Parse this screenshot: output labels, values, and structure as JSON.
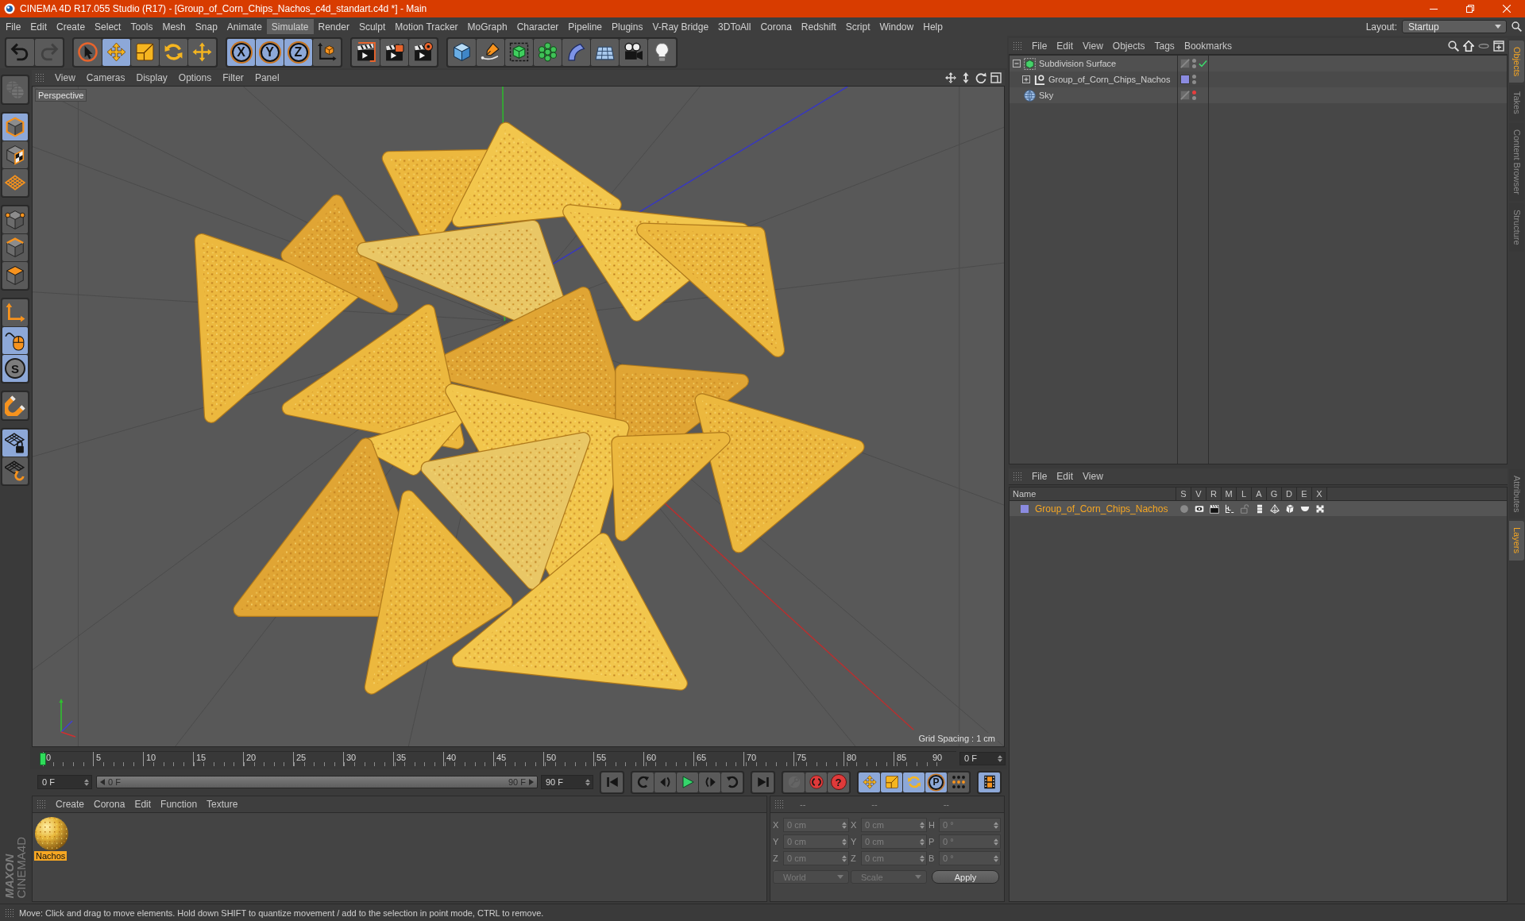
{
  "window": {
    "title": "CINEMA 4D R17.055 Studio (R17) - [Group_of_Corn_Chips_Nachos_c4d_standart.c4d *] - Main"
  },
  "menubar": {
    "items": [
      {
        "label": "File",
        "selected": false
      },
      {
        "label": "Edit",
        "selected": false
      },
      {
        "label": "Create",
        "selected": false
      },
      {
        "label": "Select",
        "selected": false
      },
      {
        "label": "Tools",
        "selected": false
      },
      {
        "label": "Mesh",
        "selected": false
      },
      {
        "label": "Snap",
        "selected": false
      },
      {
        "label": "Animate",
        "selected": false
      },
      {
        "label": "Simulate",
        "selected": true
      },
      {
        "label": "Render",
        "selected": false
      },
      {
        "label": "Sculpt",
        "selected": false
      },
      {
        "label": "Motion Tracker",
        "selected": false
      },
      {
        "label": "MoGraph",
        "selected": false
      },
      {
        "label": "Character",
        "selected": false
      },
      {
        "label": "Pipeline",
        "selected": false
      },
      {
        "label": "Plugins",
        "selected": false
      },
      {
        "label": "V-Ray Bridge",
        "selected": false
      },
      {
        "label": "3DToAll",
        "selected": false
      },
      {
        "label": "Corona",
        "selected": false
      },
      {
        "label": "Redshift",
        "selected": false
      },
      {
        "label": "Script",
        "selected": false
      },
      {
        "label": "Window",
        "selected": false
      },
      {
        "label": "Help",
        "selected": false
      }
    ],
    "layout_label": "Layout:",
    "layout_value": "Startup"
  },
  "toolbar": {
    "groups": [
      {
        "buttons": [
          {
            "kind": "undo",
            "active": false,
            "disabled": false
          },
          {
            "kind": "redo",
            "active": false,
            "disabled": true
          }
        ]
      },
      {
        "buttons": [
          {
            "kind": "select",
            "active": false,
            "disabled": false
          },
          {
            "kind": "move",
            "active": true,
            "disabled": false
          },
          {
            "kind": "scale",
            "active": false,
            "disabled": false
          },
          {
            "kind": "rotate",
            "active": false,
            "disabled": false
          },
          {
            "kind": "transform",
            "active": false,
            "disabled": false
          }
        ]
      },
      {
        "buttons": [
          {
            "kind": "axis",
            "label": "X",
            "active": true,
            "disabled": false
          },
          {
            "kind": "axis",
            "label": "Y",
            "active": true,
            "disabled": false
          },
          {
            "kind": "axis",
            "label": "Z",
            "active": true,
            "disabled": false
          },
          {
            "kind": "coordsys",
            "active": false,
            "disabled": false
          }
        ]
      },
      {
        "buttons": [
          {
            "kind": "renderview",
            "active": false,
            "disabled": false
          },
          {
            "kind": "renderpicture",
            "active": false,
            "disabled": false
          },
          {
            "kind": "rendersettings",
            "active": false,
            "disabled": false
          }
        ]
      },
      {
        "buttons": [
          {
            "kind": "cube",
            "active": false,
            "disabled": false
          },
          {
            "kind": "pen",
            "active": false,
            "disabled": false
          },
          {
            "kind": "subdivision",
            "active": false,
            "disabled": false
          },
          {
            "kind": "cloner",
            "active": false,
            "disabled": false
          },
          {
            "kind": "bend",
            "active": false,
            "disabled": false
          },
          {
            "kind": "floor",
            "active": false,
            "disabled": false
          },
          {
            "kind": "camera",
            "active": false,
            "disabled": false
          },
          {
            "kind": "light",
            "active": false,
            "disabled": false
          }
        ]
      }
    ]
  },
  "left_tools": {
    "groups": [
      {
        "buttons": [
          {
            "kind": "editable",
            "active": false,
            "disabled": true
          }
        ]
      },
      {
        "buttons": [
          {
            "kind": "model",
            "active": true,
            "disabled": false
          },
          {
            "kind": "texture",
            "active": false,
            "disabled": false
          },
          {
            "kind": "workplane",
            "active": false,
            "disabled": false
          }
        ]
      },
      {
        "buttons": [
          {
            "kind": "points",
            "active": false,
            "disabled": false
          },
          {
            "kind": "edges",
            "active": false,
            "disabled": false
          },
          {
            "kind": "polygons",
            "active": false,
            "disabled": false
          }
        ]
      },
      {
        "buttons": [
          {
            "kind": "axismode",
            "active": false,
            "disabled": false
          },
          {
            "kind": "tweak",
            "active": true,
            "disabled": false
          },
          {
            "kind": "solo",
            "label": "S",
            "active": true,
            "disabled": false
          }
        ]
      },
      {
        "buttons": [
          {
            "kind": "snap",
            "active": false,
            "disabled": false
          }
        ]
      },
      {
        "buttons": [
          {
            "kind": "planelock",
            "active": true,
            "disabled": false
          },
          {
            "kind": "planealign",
            "active": false,
            "disabled": false
          }
        ]
      }
    ]
  },
  "viewport": {
    "menu": [
      "View",
      "Cameras",
      "Display",
      "Options",
      "Filter",
      "Panel"
    ],
    "camera": "Perspective",
    "grid_spacing": "Grid Spacing : 1 cm"
  },
  "timeline": {
    "ruler_labels": [
      "0",
      "5",
      "10",
      "15",
      "20",
      "25",
      "30",
      "35",
      "40",
      "45",
      "50",
      "55",
      "60",
      "65",
      "70",
      "75",
      "80",
      "85",
      "90"
    ],
    "level": 0,
    "current_frame": "0 F"
  },
  "playback": {
    "start_field": "0 F",
    "range": {
      "start": "0 F",
      "end": "90 F",
      "level": 1
    },
    "end_field": "90 F",
    "groups": [
      {
        "buttons": [
          {
            "kind": "start",
            "active": false,
            "disabled": false
          }
        ]
      },
      {
        "buttons": [
          {
            "kind": "prevkey",
            "active": false,
            "disabled": false
          },
          {
            "kind": "prevframe",
            "active": false,
            "disabled": false
          },
          {
            "kind": "play",
            "active": false,
            "disabled": false
          },
          {
            "kind": "nextframe",
            "active": false,
            "disabled": false
          },
          {
            "kind": "nextkey",
            "active": false,
            "disabled": false
          }
        ]
      },
      {
        "buttons": [
          {
            "kind": "end",
            "active": false,
            "disabled": false
          }
        ]
      },
      {
        "buttons": [
          {
            "kind": "autokey",
            "active": false,
            "disabled": true
          },
          {
            "kind": "record",
            "active": false,
            "disabled": false
          },
          {
            "kind": "keyselect",
            "label": "?",
            "active": false,
            "disabled": false
          }
        ]
      },
      {
        "buttons": [
          {
            "kind": "poskey",
            "active": true,
            "disabled": false
          },
          {
            "kind": "scalekey",
            "active": true,
            "disabled": false
          },
          {
            "kind": "rotkey",
            "active": true,
            "disabled": false
          },
          {
            "kind": "paramkey",
            "label": "P",
            "active": true,
            "disabled": false
          },
          {
            "kind": "plakey",
            "active": false,
            "disabled": false
          }
        ]
      },
      {
        "buttons": [
          {
            "kind": "timeline",
            "active": true,
            "disabled": false
          }
        ]
      }
    ]
  },
  "material_manager": {
    "menu": [
      "Create",
      "Corona",
      "Edit",
      "Function",
      "Texture"
    ],
    "materials": [
      {
        "name": "Nachos",
        "selected": true
      }
    ]
  },
  "coordinates": {
    "headers": [
      "--",
      "--",
      "--"
    ],
    "disabled": true,
    "rows": [
      {
        "cells": [
          {
            "label": "X",
            "value": "0 cm"
          },
          {
            "label": "X",
            "value": "0 cm"
          },
          {
            "label": "H",
            "value": "0 °"
          }
        ]
      },
      {
        "cells": [
          {
            "label": "Y",
            "value": "0 cm"
          },
          {
            "label": "Y",
            "value": "0 cm"
          },
          {
            "label": "P",
            "value": "0 °"
          }
        ]
      },
      {
        "cells": [
          {
            "label": "Z",
            "value": "0 cm"
          },
          {
            "label": "Z",
            "value": "0 cm"
          },
          {
            "label": "B",
            "value": "0 °"
          }
        ]
      }
    ],
    "mode": "World",
    "size_mode": "Scale",
    "apply": "Apply"
  },
  "logo": {
    "lines": [
      "MAXON",
      "CINEMA4D"
    ]
  },
  "object_manager": {
    "menu": [
      "File",
      "Edit",
      "View",
      "Objects",
      "Tags",
      "Bookmarks"
    ],
    "objects": [
      {
        "name": "Subdivision Surface",
        "kind": "subdivision",
        "selected": false,
        "expanded": true,
        "enabled": true,
        "editor_hidden": false,
        "render_hidden": false,
        "children": [
          {
            "name": "Group_of_Corn_Chips_Nachos",
            "kind": "null",
            "selected": false,
            "expanded": false,
            "color": "#8b8be0",
            "editor_hidden": false,
            "render_hidden": false
          }
        ]
      },
      {
        "name": "Sky",
        "kind": "sky",
        "selected": false,
        "editor_hidden": true,
        "render_hidden": false
      }
    ]
  },
  "layer_manager": {
    "menu": [
      "File",
      "Edit",
      "View"
    ],
    "columns": [
      "Name",
      "S",
      "V",
      "R",
      "M",
      "L",
      "A",
      "G",
      "D",
      "E",
      "X"
    ],
    "layers": [
      {
        "name": "Group_of_Corn_Chips_Nachos",
        "color": "#8b8be0",
        "selected": true,
        "flags": [
          {
            "kind": "solo",
            "on": false
          },
          {
            "kind": "visible",
            "on": true
          },
          {
            "kind": "render",
            "on": true
          },
          {
            "kind": "manager",
            "on": true
          },
          {
            "kind": "locked",
            "on": false
          },
          {
            "kind": "animation",
            "on": true
          },
          {
            "kind": "generators",
            "on": true
          },
          {
            "kind": "deformers",
            "on": true
          },
          {
            "kind": "expressions",
            "on": true
          },
          {
            "kind": "xrefs",
            "on": true
          }
        ]
      }
    ]
  },
  "side_tabs": {
    "upper": [
      {
        "label": "Objects",
        "selected": true
      },
      {
        "label": "Takes",
        "selected": false
      },
      {
        "label": "Content Browser",
        "selected": false
      },
      {
        "label": "Structure",
        "selected": false
      }
    ],
    "lower": [
      {
        "label": "Attributes",
        "selected": false
      },
      {
        "label": "Layers",
        "selected": true
      }
    ]
  },
  "status_bar": {
    "text": "Move: Click and drag to move elements. Hold down SHIFT to quantize movement / add to the selection in point mode, CTRL to remove."
  }
}
